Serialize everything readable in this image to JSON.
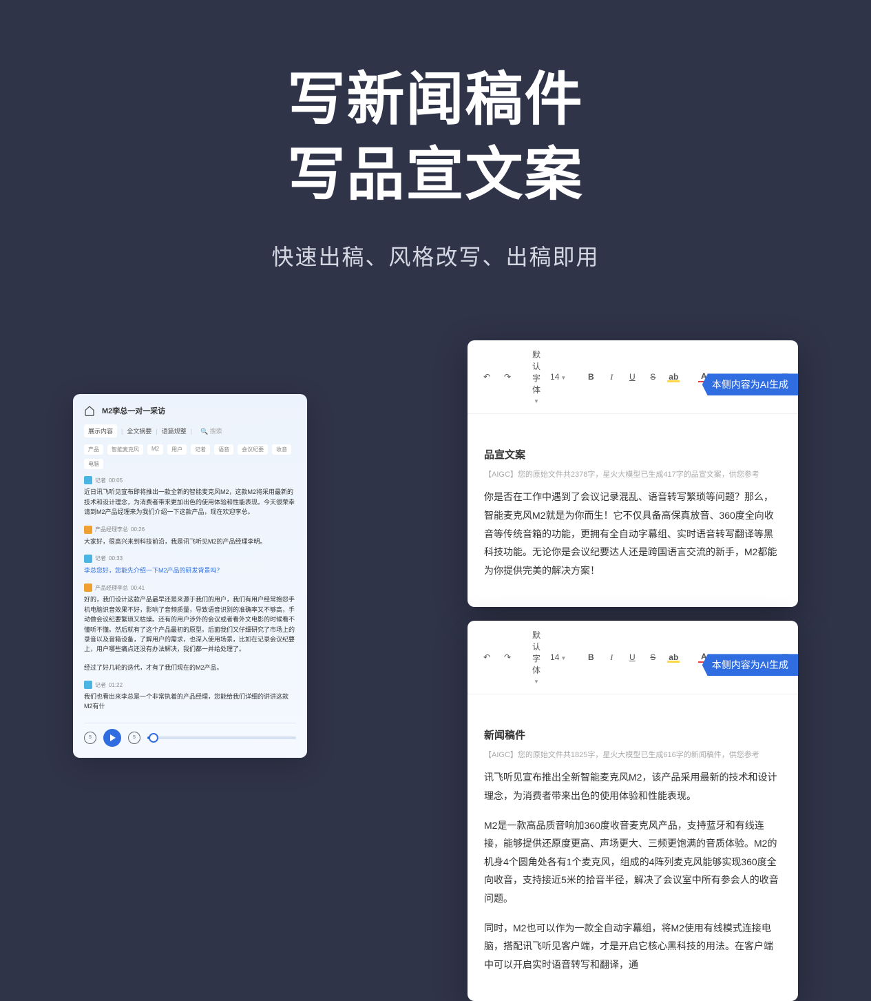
{
  "hero": {
    "line1": "写新闻稿件",
    "line2": "写品宣文案",
    "subtitle": "快速出稿、风格改写、出稿即用"
  },
  "left": {
    "title": "M2李总一对一采访",
    "tabs": {
      "t1": "展示内容",
      "t2": "全文摘要",
      "t3": "语篇规整",
      "search": "搜索"
    },
    "tags": [
      "产品",
      "智能麦克风",
      "M2",
      "用户",
      "记者",
      "语音",
      "会议纪要",
      "收音",
      "电脑"
    ],
    "msgs": [
      {
        "role": "记者",
        "time": "00:05",
        "avatar": "reporter",
        "text": "近日讯飞听见宣布即将推出一款全新的智能麦克风M2，这款M2将采用最新的技术和设计理念，为消费者带来更加出色的使用体验和性能表现。今天很荣幸请到M2产品经理来为我们介绍一下这款产品，现在欢迎李总。"
      },
      {
        "role": "产品经理李总",
        "time": "00:26",
        "avatar": "pm",
        "text": "大家好，很高兴来到科技前沿，我是讯飞听见M2的产品经理李明。"
      },
      {
        "role": "记者",
        "time": "00:33",
        "avatar": "reporter",
        "text": "李总您好，您能先介绍一下M2产品的研发背景吗？"
      },
      {
        "role": "产品经理李总",
        "time": "00:41",
        "avatar": "pm",
        "text": "好的，我们设计这款产品最早还是来源于我们的用户，我们有用户经常抱怨手机电脑识音效果不好，影响了音频质量，导致语音识别的准确率又不够高，手动做会议纪要繁琐又枯燥。还有的用户涉外的会议或者看外文电影的时候看不懂听不懂。然后就有了这个产品最初的原型。后面我们又仔细研究了市场上的录音以及音箱设备，了解用户的需求，也深入使用场景，比如在记录会议纪要上，用户哪些痛点还没有办法解决，我们都一并给处理了。"
      },
      {
        "role": "",
        "time": "",
        "avatar": "",
        "text": "经过了好几轮的迭代，才有了我们现在的M2产品。"
      },
      {
        "role": "记者",
        "time": "01:22",
        "avatar": "reporter",
        "text": "我们也看出来李总是一个非常执着的产品经理，您能给我们详细的讲讲这款M2有什"
      }
    ],
    "player": {
      "back": "5",
      "fwd": "5"
    }
  },
  "toolbar": {
    "undo": "↶",
    "redo": "↷",
    "font": "默认字体",
    "size": "14",
    "bold": "B",
    "italic": "I",
    "underline": "U",
    "strike": "S",
    "highlight": "ab",
    "fontcolor": "A",
    "align": "≡",
    "list": "⋮≡",
    "check": "☑"
  },
  "cards": [
    {
      "badge": "本侧内容为AI生成",
      "title": "品宣文案",
      "meta": "【AIGC】您的原始文件共2378字，星火大模型已生成417字的品宣文案，供您参考",
      "paras": [
        "你是否在工作中遇到了会议记录混乱、语音转写繁琐等问题？那么，智能麦克风M2就是为你而生！它不仅具备高保真放音、360度全向收音等传统音箱的功能，更拥有全自动字幕组、实时语音转写翻译等黑科技功能。无论你是会议纪要达人还是跨国语言交流的新手，M2都能为你提供完美的解决方案！"
      ]
    },
    {
      "badge": "本侧内容为AI生成",
      "title": "新闻稿件",
      "meta": "【AIGC】您的原始文件共1825字，星火大模型已生成616字的新闻稿件，供您参考",
      "paras": [
        "讯飞听见宣布推出全新智能麦克风M2，该产品采用最新的技术和设计理念，为消费者带来出色的使用体验和性能表现。",
        "M2是一款高品质音响加360度收音麦克风产品，支持蓝牙和有线连接，能够提供还原度更高、声场更大、三频更饱满的音质体验。M2的机身4个圆角处各有1个麦克风，组成的4阵列麦克风能够实现360度全向收音，支持接近5米的拾音半径，解决了会议室中所有参会人的收音问题。",
        "同时，M2也可以作为一款全自动字幕组，将M2使用有线模式连接电脑，搭配讯飞听见客户端，才是开启它核心黑科技的用法。在客户端中可以开启实时语音转写和翻译，通"
      ]
    }
  ]
}
